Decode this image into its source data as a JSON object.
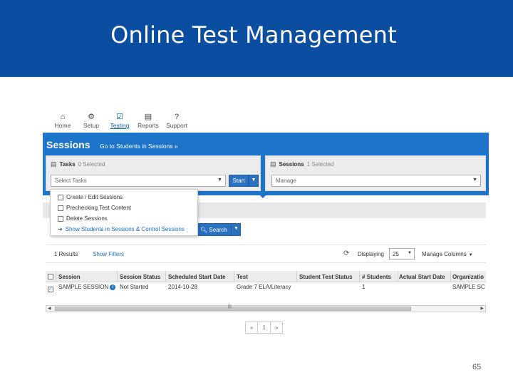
{
  "slide": {
    "title": "Online Test Management",
    "page_number": "65"
  },
  "nav": [
    {
      "label": "Home",
      "icon": "⌂"
    },
    {
      "label": "Setup",
      "icon": "⚙"
    },
    {
      "label": "Testing",
      "icon": "☑"
    },
    {
      "label": "Reports",
      "icon": "▤"
    },
    {
      "label": "Support",
      "icon": "?"
    }
  ],
  "sessions": {
    "title": "Sessions",
    "link": "Go to Students in Sessions »"
  },
  "tasks_panel": {
    "title": "Tasks",
    "selected": "0 Selected",
    "dropdown": "Select Tasks",
    "start": "Start"
  },
  "sessions_panel": {
    "title": "Sessions",
    "selected": "1 Selected",
    "dropdown": "Manage"
  },
  "task_menu": [
    {
      "label": "Create / Edit Sessions"
    },
    {
      "label": "Prechecking Test Content"
    },
    {
      "label": "Delete Sessions"
    },
    {
      "label": "Show Students in Sessions & Control Sessions"
    }
  ],
  "search_button": "Search",
  "results": {
    "count": "1 Results",
    "filters": "Show Filters",
    "displaying": "Displaying",
    "page_size": "25",
    "manage": "Manage Columns"
  },
  "table": {
    "headers": [
      "Session",
      "Session Status",
      "Scheduled Start Date",
      "Test",
      "Student Test Status",
      "# Students",
      "Actual Start Date",
      "Organizatio"
    ],
    "rows": [
      [
        "SAMPLE SESSION",
        "Not Started",
        "2014-10-28",
        "Grade 7 ELA/Literacy",
        "",
        "1",
        "",
        "SAMPLE SC"
      ]
    ]
  },
  "pager": {
    "prev": "«",
    "page": "1",
    "next": "»"
  },
  "colors": {
    "title_bar": "#0a4ea2",
    "sessions_bar": "#1e74c9",
    "link": "#1e6bc2"
  }
}
